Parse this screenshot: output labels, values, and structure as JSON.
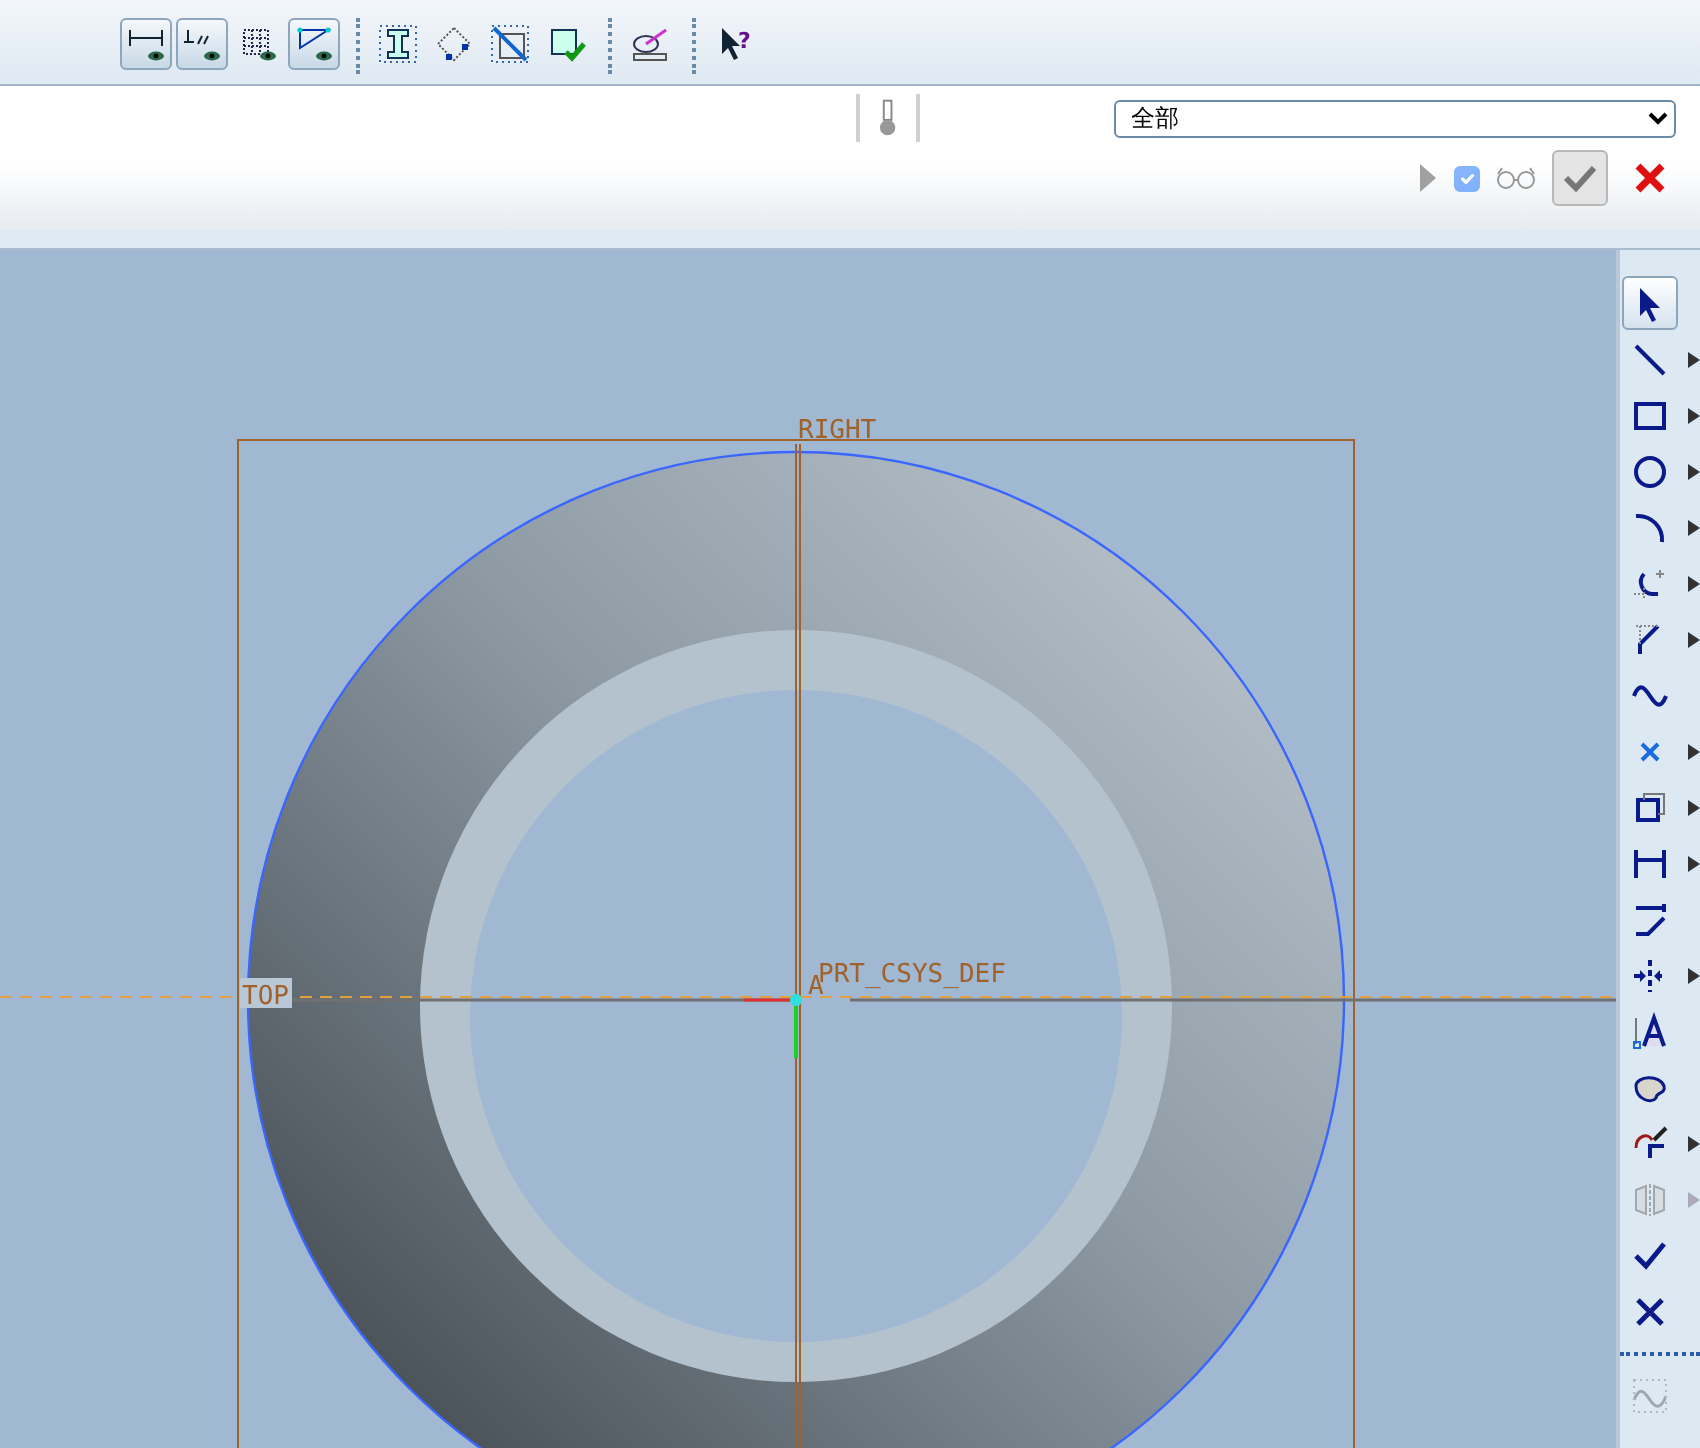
{
  "toolbar": {
    "groups": [
      [
        {
          "pressed": true
        },
        {
          "pressed": true
        },
        {
          "pressed": false
        },
        {
          "pressed": true
        }
      ],
      [
        {
          "pressed": false
        },
        {
          "pressed": false
        },
        {
          "pressed": false
        },
        {
          "pressed": false
        }
      ],
      [
        {
          "pressed": false
        }
      ],
      [
        {
          "pressed": false
        }
      ]
    ],
    "help_symbol": "?"
  },
  "filter": {
    "value": "全部"
  },
  "actions": {
    "play": {
      "disabled": true
    },
    "checkbox": {
      "checked": true,
      "disabled": true
    },
    "ok": {
      "disabled": true
    }
  },
  "canvas": {
    "plane_labels": [
      "RIGHT",
      "TOP"
    ],
    "csys_label": "PRT_CSYS_DEF",
    "axis_label": "A"
  },
  "sketch_tools": [
    {
      "selected": true,
      "has_menu": false,
      "disabled": false
    },
    {
      "selected": false,
      "has_menu": true,
      "disabled": false
    },
    {
      "selected": false,
      "has_menu": true,
      "disabled": false
    },
    {
      "selected": false,
      "has_menu": true,
      "disabled": false
    },
    {
      "selected": false,
      "has_menu": true,
      "disabled": false
    },
    {
      "selected": false,
      "has_menu": true,
      "disabled": false
    },
    {
      "selected": false,
      "has_menu": true,
      "disabled": false
    },
    {
      "selected": false,
      "has_menu": false,
      "disabled": false
    },
    {
      "selected": false,
      "has_menu": true,
      "disabled": false
    },
    {
      "selected": false,
      "has_menu": true,
      "disabled": false
    },
    {
      "selected": false,
      "has_menu": true,
      "disabled": false
    },
    {
      "selected": false,
      "has_menu": false,
      "disabled": false
    },
    {
      "selected": false,
      "has_menu": true,
      "disabled": false
    },
    {
      "selected": false,
      "has_menu": false,
      "disabled": false
    },
    {
      "selected": false,
      "has_menu": false,
      "disabled": false
    },
    {
      "selected": false,
      "has_menu": true,
      "disabled": false
    },
    {
      "selected": false,
      "has_menu": true,
      "disabled": true
    },
    {
      "selected": false,
      "has_menu": false,
      "disabled": false
    },
    {
      "selected": false,
      "has_menu": false,
      "disabled": false
    }
  ],
  "sketch_tools_more": [
    {
      "selected": false,
      "has_menu": false,
      "disabled": true
    }
  ]
}
